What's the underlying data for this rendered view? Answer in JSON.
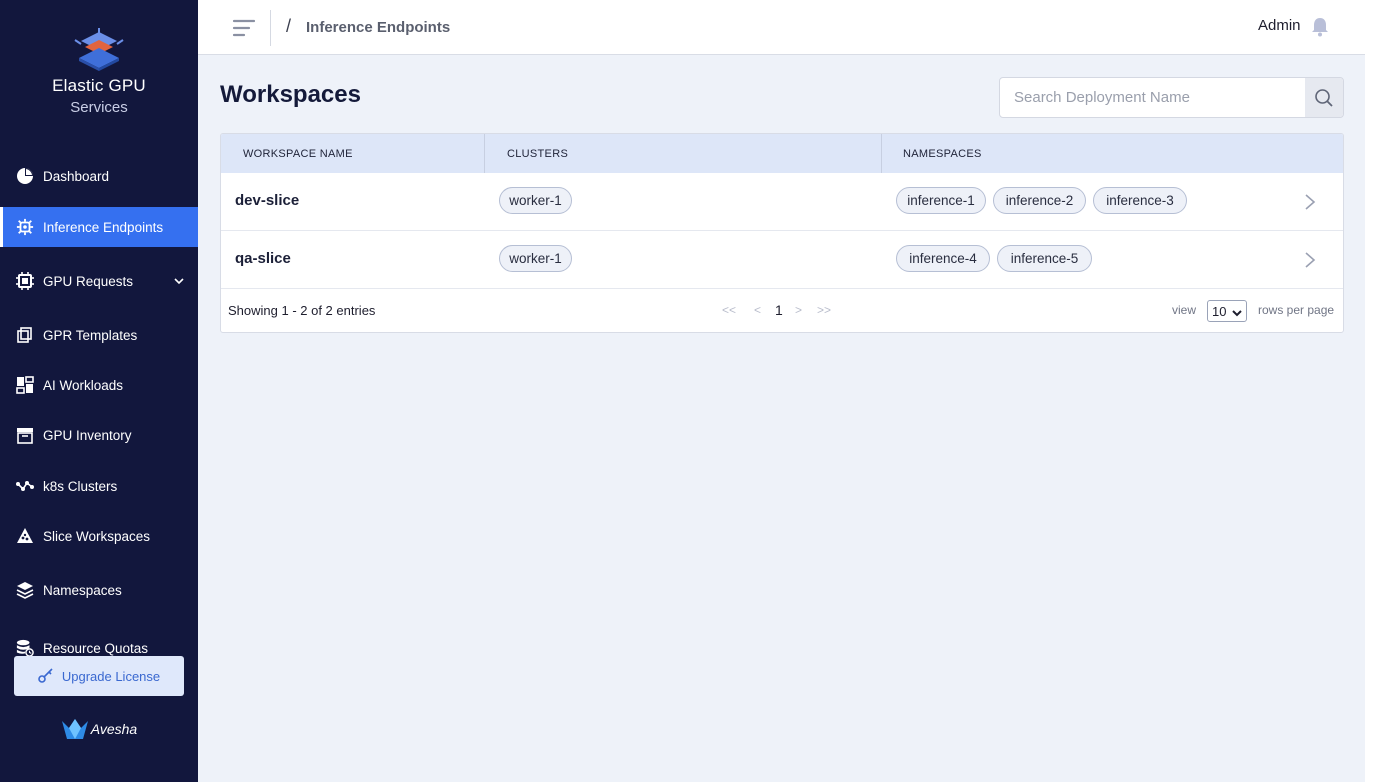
{
  "brand": {
    "title": "Elastic GPU",
    "subtitle": "Services"
  },
  "sidebar": {
    "items": [
      {
        "label": "Dashboard",
        "icon": "pie-chart-icon"
      },
      {
        "label": "Inference Endpoints",
        "icon": "chip-gear-icon",
        "active": true
      },
      {
        "label": "GPU Requests",
        "icon": "cpu-icon",
        "expandable": true
      },
      {
        "label": "GPR Templates",
        "icon": "copy-icon"
      },
      {
        "label": "AI Workloads",
        "icon": "dashboard-grid-icon"
      },
      {
        "label": "GPU Inventory",
        "icon": "archive-box-icon"
      },
      {
        "label": "k8s Clusters",
        "icon": "network-nodes-icon"
      },
      {
        "label": "Slice Workspaces",
        "icon": "slice-triangle-icon"
      },
      {
        "label": "Namespaces",
        "icon": "layers-icon"
      },
      {
        "label": "Resource Quotas",
        "icon": "coins-clock-icon"
      }
    ],
    "upgrade_label": "Upgrade License",
    "footer_logo": "Avesha"
  },
  "topbar": {
    "breadcrumb_separator": "/",
    "breadcrumb": "Inference Endpoints",
    "user": "Admin"
  },
  "main": {
    "title": "Workspaces",
    "search_placeholder": "Search Deployment Name",
    "columns": [
      "WORKSPACE NAME",
      "CLUSTERS",
      "NAMESPACES"
    ],
    "rows": [
      {
        "name": "dev-slice",
        "clusters": [
          "worker-1"
        ],
        "namespaces": [
          "inference-1",
          "inference-2",
          "inference-3"
        ]
      },
      {
        "name": "qa-slice",
        "clusters": [
          "worker-1"
        ],
        "namespaces": [
          "inference-4",
          "inference-5"
        ]
      }
    ],
    "pagination": {
      "showing": "Showing 1 - 2 of 2 entries",
      "first": "<<",
      "prev": "<",
      "page": "1",
      "next": ">",
      "last": ">>",
      "view_label": "view",
      "rows_per_page": "10",
      "rows_per_page_label": "rows per page"
    }
  },
  "colors": {
    "sidebar_bg": "#12173d",
    "active_bg": "#3570f0",
    "header_bg": "#dde6f8",
    "page_bg": "#eef2f9"
  }
}
